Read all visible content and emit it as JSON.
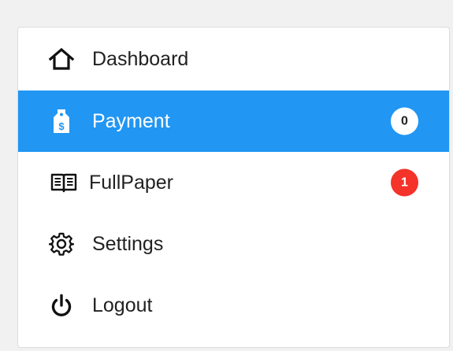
{
  "menu": {
    "items": [
      {
        "id": "dashboard",
        "label": "Dashboard",
        "icon": "home-icon"
      },
      {
        "id": "payment",
        "label": "Payment",
        "icon": "price-tag-icon",
        "badge": "0",
        "active": true
      },
      {
        "id": "fullpaper",
        "label": "FullPaper",
        "icon": "book-icon",
        "badge": "1"
      },
      {
        "id": "settings",
        "label": "Settings",
        "icon": "gear-icon"
      },
      {
        "id": "logout",
        "label": "Logout",
        "icon": "power-icon"
      }
    ]
  },
  "colors": {
    "active_bg": "#2196f3",
    "badge_alert": "#f4332a",
    "badge_neutral_bg": "#ffffff",
    "text": "#212121"
  }
}
